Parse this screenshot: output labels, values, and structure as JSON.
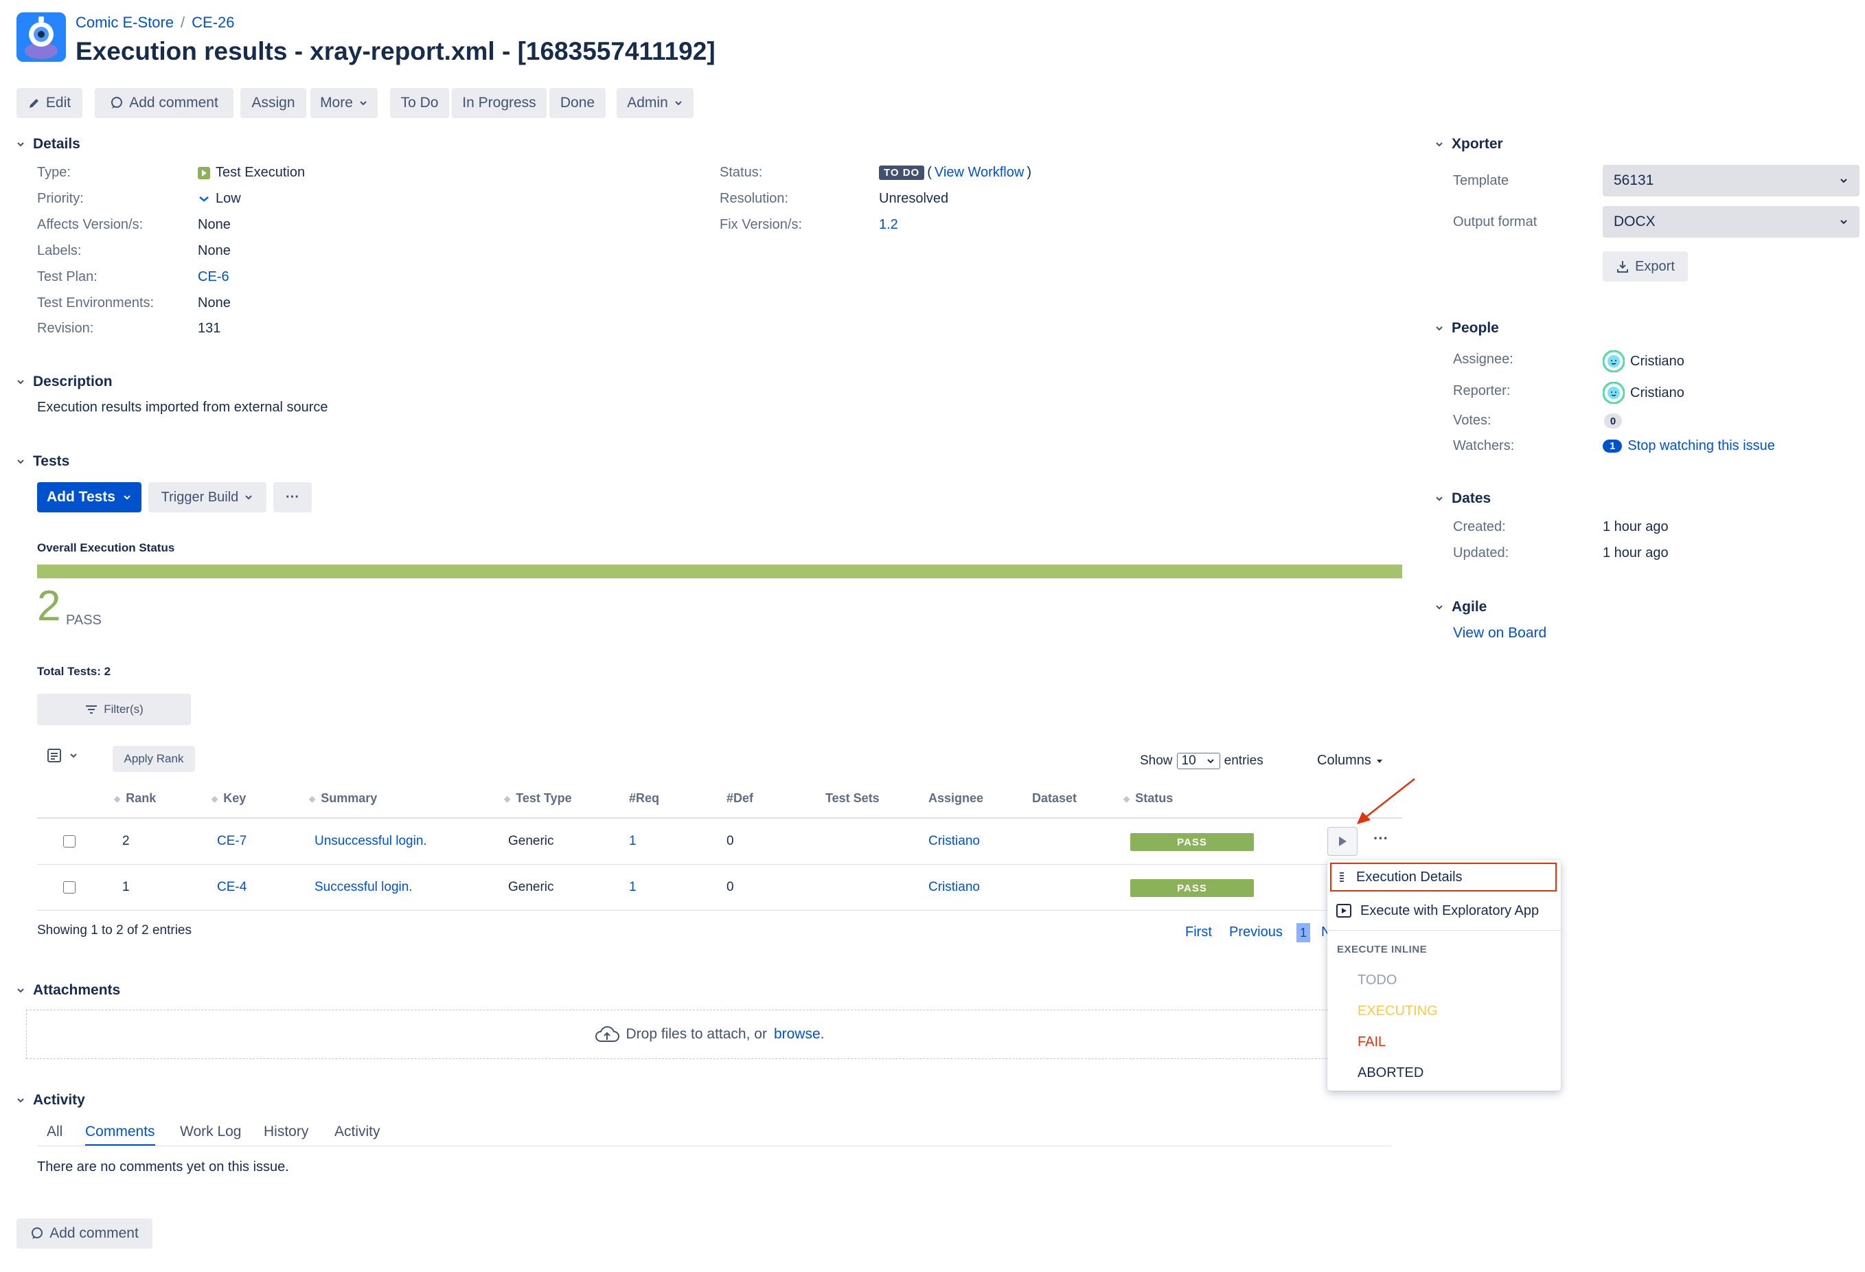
{
  "breadcrumb": {
    "project": "Comic E-Store",
    "issue": "CE-26"
  },
  "title": "Execution results - xray-report.xml - [1683557411192]",
  "toolbar": {
    "edit": "Edit",
    "add_comment": "Add comment",
    "assign": "Assign",
    "more": "More",
    "todo": "To Do",
    "in_progress": "In Progress",
    "done": "Done",
    "admin": "Admin"
  },
  "details": {
    "header": "Details",
    "type_label": "Type:",
    "type_value": "Test Execution",
    "priority_label": "Priority:",
    "priority_value": "Low",
    "affects_label": "Affects Version/s:",
    "affects_value": "None",
    "labels_label": "Labels:",
    "labels_value": "None",
    "plan_label": "Test Plan:",
    "plan_value": "CE-6",
    "env_label": "Test Environments:",
    "env_value": "None",
    "revision_label": "Revision:",
    "revision_value": "131",
    "status_label": "Status:",
    "status_badge": "TO DO",
    "view_workflow": "View Workflow",
    "resolution_label": "Resolution:",
    "resolution_value": "Unresolved",
    "fix_label": "Fix Version/s:",
    "fix_value": "1.2"
  },
  "description": {
    "header": "Description",
    "text": "Execution results imported from external source"
  },
  "tests": {
    "header": "Tests",
    "add_tests": "Add Tests",
    "trigger_build": "Trigger Build",
    "more_dots": "···",
    "overall_label": "Overall Execution Status",
    "pass_count": "2",
    "pass_label": "PASS",
    "pass_ratio": 1.0,
    "total_tests": "Total Tests: 2",
    "filters": "Filter(s)",
    "apply_rank": "Apply Rank",
    "show": "Show",
    "entries_value": "10",
    "entries": "entries",
    "columns": "Columns",
    "headers": [
      "Rank",
      "Key",
      "Summary",
      "Test Type",
      "#Req",
      "#Def",
      "Test Sets",
      "Assignee",
      "Dataset",
      "Status"
    ],
    "rows": [
      {
        "rank": "2",
        "key": "CE-7",
        "summary": "Unsuccessful login.",
        "type": "Generic",
        "req": "1",
        "def": "0",
        "assignee": "Cristiano",
        "status": "PASS"
      },
      {
        "rank": "1",
        "key": "CE-4",
        "summary": "Successful login.",
        "type": "Generic",
        "req": "1",
        "def": "0",
        "assignee": "Cristiano",
        "status": "PASS"
      }
    ],
    "showing": "Showing 1 to 2 of 2 entries",
    "pager_first": "First",
    "pager_previous": "Previous",
    "pager_current": "1",
    "pager_next": "N"
  },
  "menu": {
    "execution_details": "Execution Details",
    "exploratory": "Execute with Exploratory App",
    "execute_inline": "EXECUTE INLINE",
    "todo": "TODO",
    "executing": "EXECUTING",
    "fail": "FAIL",
    "aborted": "ABORTED"
  },
  "attachments": {
    "header": "Attachments",
    "drop_text": "Drop files to attach, or",
    "browse": "browse."
  },
  "activity": {
    "header": "Activity",
    "tabs": [
      "All",
      "Comments",
      "Work Log",
      "History",
      "Activity"
    ],
    "empty": "There are no comments yet on this issue.",
    "add_comment": "Add comment"
  },
  "xporter": {
    "header": "Xporter",
    "template_label": "Template",
    "template_value": "56131",
    "format_label": "Output format",
    "format_value": "DOCX",
    "export": "Export"
  },
  "people": {
    "header": "People",
    "assignee_label": "Assignee:",
    "assignee_value": "Cristiano",
    "reporter_label": "Reporter:",
    "reporter_value": "Cristiano",
    "votes_label": "Votes:",
    "votes_value": "0",
    "watchers_label": "Watchers:",
    "watchers_count": "1",
    "watch_link": "Stop watching this issue"
  },
  "dates": {
    "header": "Dates",
    "created_label": "Created:",
    "created_value": "1 hour ago",
    "updated_label": "Updated:",
    "updated_value": "1 hour ago"
  },
  "agile": {
    "header": "Agile",
    "view_board": "View on Board"
  },
  "colors": {
    "accent": "#0052CC",
    "pass": "#8BB258",
    "progress": "#A5C26C",
    "menu_border": "#DE350B"
  }
}
